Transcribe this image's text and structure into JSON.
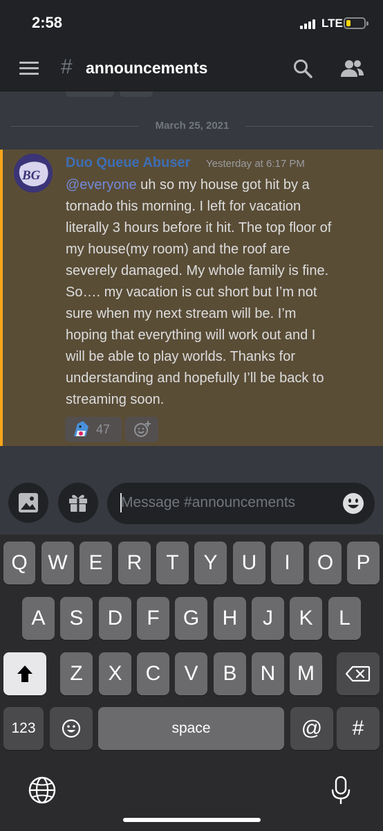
{
  "status_bar": {
    "time": "2:58",
    "network": "LTE",
    "battery_level": 0.25
  },
  "header": {
    "hash": "#",
    "channel": "announcements"
  },
  "date_divider": "March 25, 2021",
  "message": {
    "author": "Duo Queue Abuser",
    "timestamp": "Yesterday at 6:17 PM",
    "avatar_text": "BG",
    "mention": "@everyone",
    "lines": [
      " uh so my house got hit by a",
      "tornado this morning. I left for vacation",
      "literally 3 hours before it hit. The top floor of",
      "my house(my room) and the roof are",
      "severely damaged. My whole family is fine.",
      "So…. my vacation is cut short but I’m not",
      "sure when my next stream will be. I’m",
      "hoping that everything will work out and I",
      "will be able to play worlds. Thanks for",
      "understanding and hopefully I’ll be back to",
      "streaming soon."
    ],
    "reaction_count": "47",
    "highlight_color": "#faa61a",
    "author_color": "#3d6eb4"
  },
  "composer": {
    "placeholder": "Message #announcements"
  },
  "keyboard": {
    "row1": [
      "Q",
      "W",
      "E",
      "R",
      "T",
      "Y",
      "U",
      "I",
      "O",
      "P"
    ],
    "row2": [
      "A",
      "S",
      "D",
      "F",
      "G",
      "H",
      "J",
      "K",
      "L"
    ],
    "row3": [
      "Z",
      "X",
      "C",
      "V",
      "B",
      "N",
      "M"
    ],
    "numbers_label": "123",
    "space_label": "space",
    "at_label": "@",
    "hash_label": "#"
  },
  "icons": [
    "hamburger-icon",
    "search-icon",
    "members-icon",
    "image-icon",
    "gift-icon",
    "emoji-icon",
    "shark-emoji-icon",
    "add-reaction-icon",
    "shift-icon",
    "backspace-icon",
    "globe-icon",
    "mic-icon"
  ]
}
